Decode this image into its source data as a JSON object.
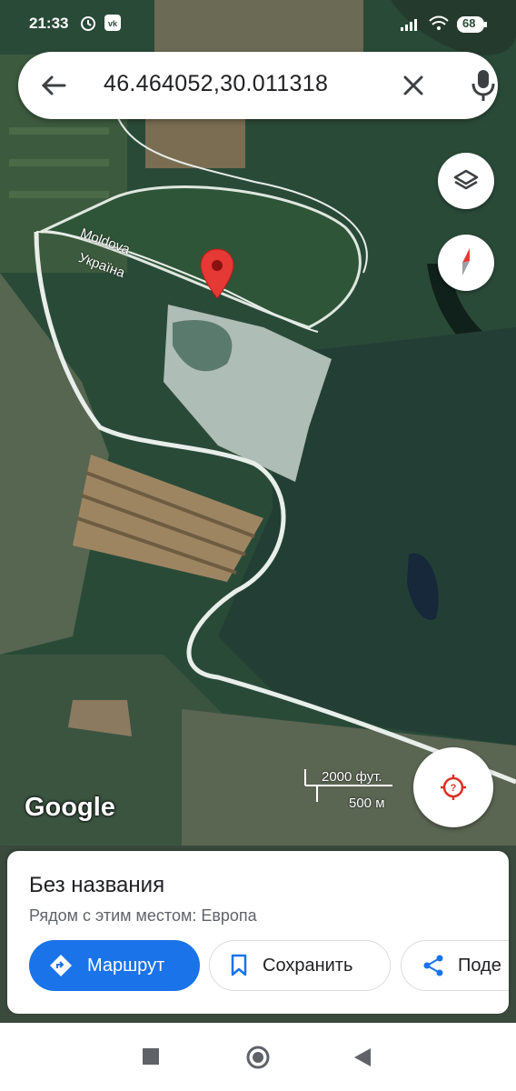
{
  "status_bar": {
    "time": "21:33",
    "battery": "68"
  },
  "search": {
    "query": "46.464052,30.011318"
  },
  "map": {
    "labels": {
      "country_a": "Moldova",
      "country_b": "Україна"
    },
    "logo": "Google",
    "scale": {
      "imperial": "2000 фут.",
      "metric": "500 м"
    }
  },
  "place": {
    "title": "Без названия",
    "subtitle": "Рядом с этим местом: Европа",
    "actions": {
      "route": "Маршрут",
      "save": "Сохранить",
      "share": "Поде"
    }
  },
  "colors": {
    "accent": "#1a73e8",
    "pin": "#e53935",
    "locate": "#d93025"
  }
}
